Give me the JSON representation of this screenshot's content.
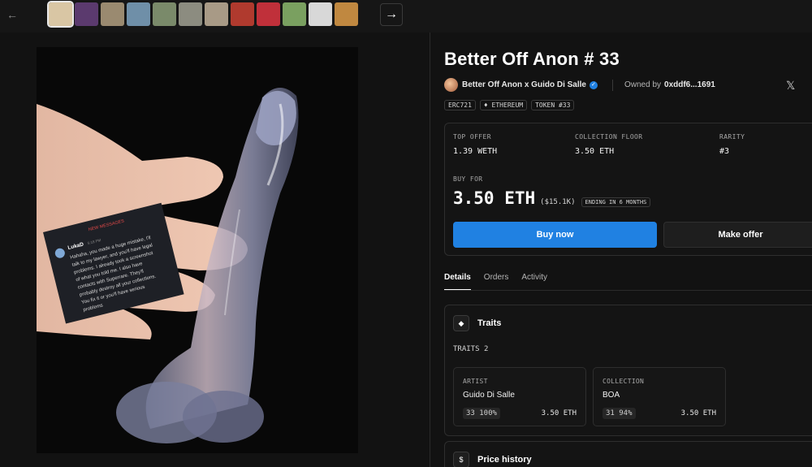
{
  "carousel": {
    "back_icon": "arrow-left-icon",
    "next_icon": "arrow-right-icon",
    "thumb_colors": [
      "#d9c6a4",
      "#5b3a6e",
      "#9a8a70",
      "#6f8fa8",
      "#7a8a6a",
      "#8c8c80",
      "#a89a86",
      "#b03a2e",
      "#c0303a",
      "#7aa060",
      "#d8d8d8",
      "#c08840"
    ]
  },
  "artwork": {
    "dm_header": "NEW MESSAGES",
    "dm_user": "LukaD",
    "dm_time": "5:18 PM",
    "dm_lines": [
      "Hahaha, you made a huge mistake, I'll",
      "talk to my lawyer, and you'll have legal",
      "problems. I already took a screenshot",
      "of what you told me. I also have",
      "contacts with Superrare. They'll",
      "probably destroy all your collections.",
      "You fix it or you'll have serious",
      "problems"
    ]
  },
  "item": {
    "title": "Better Off Anon # 33",
    "collection": "Better Off Anon x Guido Di Salle",
    "verified_icon": "check-icon",
    "owned_label": "Owned by",
    "owner": "0xddf6...1691",
    "share_icon": "x-logo-icon",
    "tags": [
      "ERC721",
      "ETHEREUM",
      "TOKEN #33"
    ]
  },
  "offer": {
    "top_offer_label": "TOP OFFER",
    "top_offer": "1.39 WETH",
    "floor_label": "COLLECTION FLOOR",
    "floor": "3.50 ETH",
    "rarity_label": "RARITY",
    "rarity": "#3",
    "buy_for_label": "BUY FOR",
    "price": "3.50 ETH",
    "usd": "($15.1K)",
    "ending": "ENDING IN 6 MONTHS",
    "buy_now": "Buy now",
    "make_offer": "Make offer"
  },
  "tabs": [
    "Details",
    "Orders",
    "Activity"
  ],
  "traits": {
    "title": "Traits",
    "count_label": "TRAITS",
    "count": "2",
    "items": [
      {
        "label": "ARTIST",
        "value": "Guido Di Salle",
        "count": "33 100%",
        "price": "3.50 ETH"
      },
      {
        "label": "COLLECTION",
        "value": "BOA",
        "count": "31 94%",
        "price": "3.50 ETH"
      }
    ]
  },
  "price_history": {
    "title": "Price history",
    "icon": "dollar-icon"
  }
}
